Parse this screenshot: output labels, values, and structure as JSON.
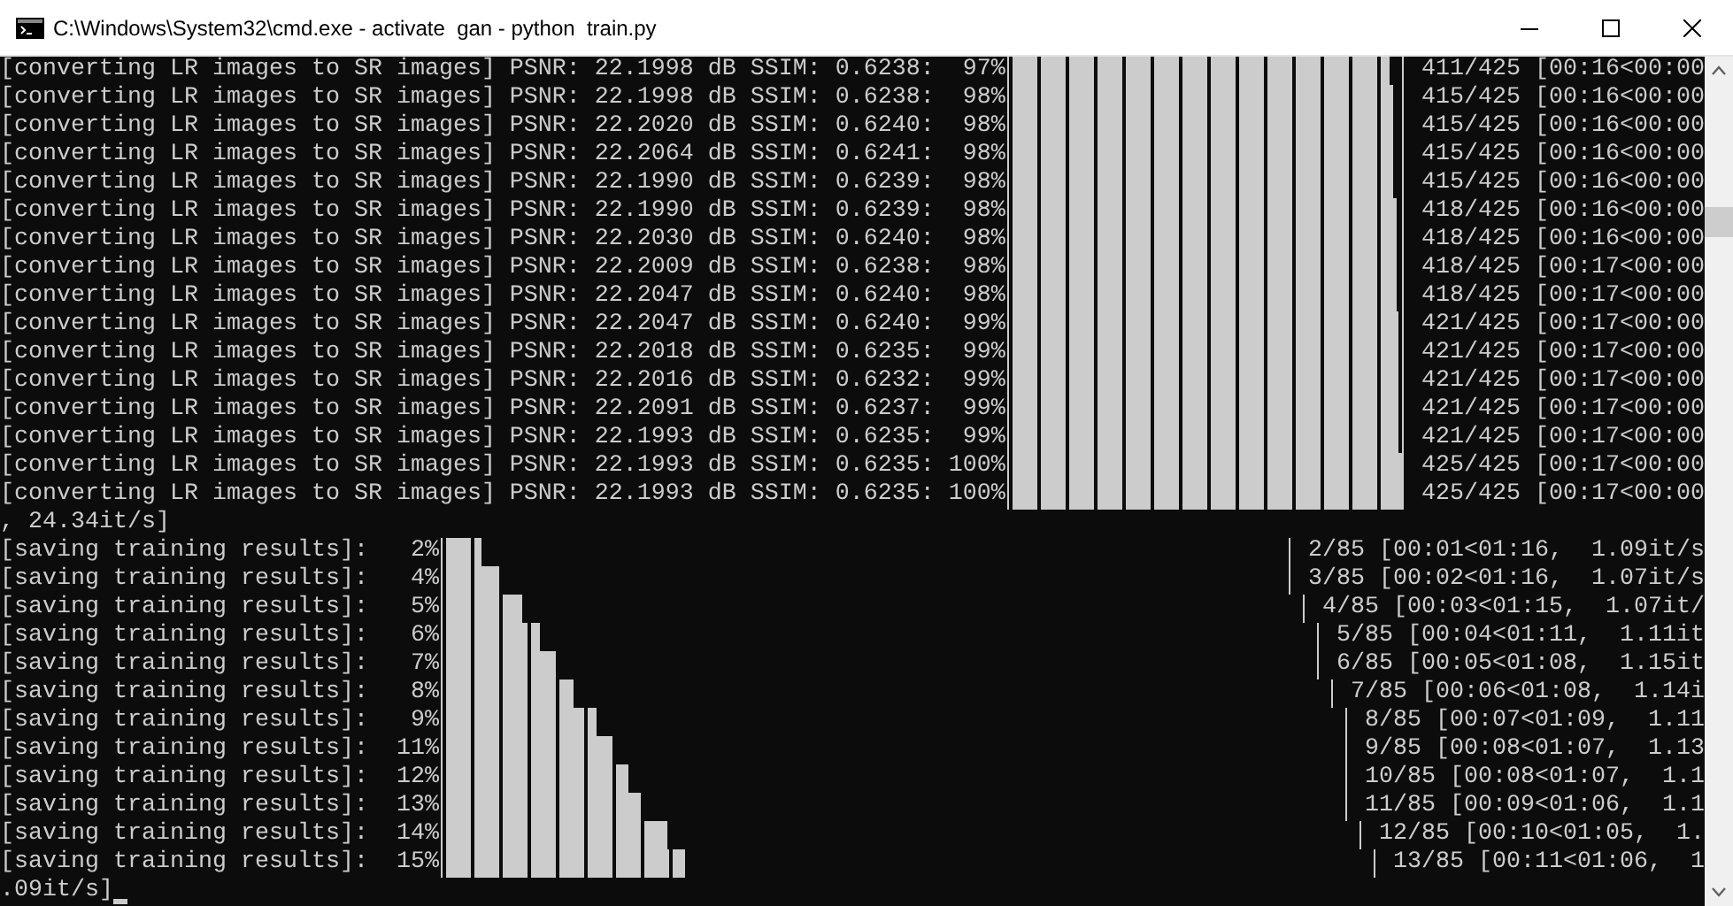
{
  "window": {
    "title": "C:\\Windows\\System32\\cmd.exe - activate  gan - python  train.py"
  },
  "console": {
    "lines": [
      {
        "kind": "progress",
        "prefix": "[converting LR images to SR images] PSNR: 22.1998 dB SSIM: 0.6238:  97%",
        "level": 0.967,
        "suffix": "411/425 [00:16<00:00"
      },
      {
        "kind": "progress",
        "prefix": "[converting LR images to SR images] PSNR: 22.1998 dB SSIM: 0.6238:  98%",
        "level": 0.976,
        "suffix": "415/425 [00:16<00:00"
      },
      {
        "kind": "progress",
        "prefix": "[converting LR images to SR images] PSNR: 22.2020 dB SSIM: 0.6240:  98%",
        "level": 0.976,
        "suffix": "415/425 [00:16<00:00"
      },
      {
        "kind": "progress",
        "prefix": "[converting LR images to SR images] PSNR: 22.2064 dB SSIM: 0.6241:  98%",
        "level": 0.976,
        "suffix": "415/425 [00:16<00:00"
      },
      {
        "kind": "progress",
        "prefix": "[converting LR images to SR images] PSNR: 22.1990 dB SSIM: 0.6239:  98%",
        "level": 0.976,
        "suffix": "415/425 [00:16<00:00"
      },
      {
        "kind": "progress",
        "prefix": "[converting LR images to SR images] PSNR: 22.1990 dB SSIM: 0.6239:  98%",
        "level": 0.984,
        "suffix": "418/425 [00:16<00:00"
      },
      {
        "kind": "progress",
        "prefix": "[converting LR images to SR images] PSNR: 22.2030 dB SSIM: 0.6240:  98%",
        "level": 0.984,
        "suffix": "418/425 [00:16<00:00"
      },
      {
        "kind": "progress",
        "prefix": "[converting LR images to SR images] PSNR: 22.2009 dB SSIM: 0.6238:  98%",
        "level": 0.984,
        "suffix": "418/425 [00:17<00:00"
      },
      {
        "kind": "progress",
        "prefix": "[converting LR images to SR images] PSNR: 22.2047 dB SSIM: 0.6240:  98%",
        "level": 0.984,
        "suffix": "418/425 [00:17<00:00"
      },
      {
        "kind": "progress",
        "prefix": "[converting LR images to SR images] PSNR: 22.2047 dB SSIM: 0.6240:  99%",
        "level": 0.991,
        "suffix": "421/425 [00:17<00:00"
      },
      {
        "kind": "progress",
        "prefix": "[converting LR images to SR images] PSNR: 22.2018 dB SSIM: 0.6235:  99%",
        "level": 0.991,
        "suffix": "421/425 [00:17<00:00"
      },
      {
        "kind": "progress",
        "prefix": "[converting LR images to SR images] PSNR: 22.2016 dB SSIM: 0.6232:  99%",
        "level": 0.991,
        "suffix": "421/425 [00:17<00:00"
      },
      {
        "kind": "progress",
        "prefix": "[converting LR images to SR images] PSNR: 22.2091 dB SSIM: 0.6237:  99%",
        "level": 0.991,
        "suffix": "421/425 [00:17<00:00"
      },
      {
        "kind": "progress",
        "prefix": "[converting LR images to SR images] PSNR: 22.1993 dB SSIM: 0.6235:  99%",
        "level": 0.991,
        "suffix": "421/425 [00:17<00:00"
      },
      {
        "kind": "progress",
        "prefix": "[converting LR images to SR images] PSNR: 22.1993 dB SSIM: 0.6235: 100%",
        "level": 1,
        "suffix": "425/425 [00:17<00:00"
      },
      {
        "kind": "progress",
        "prefix": "[converting LR images to SR images] PSNR: 22.1993 dB SSIM: 0.6235: 100%",
        "level": 1,
        "suffix": "425/425 [00:17<00:00"
      },
      {
        "kind": "text",
        "text": ", 24.34it/s]"
      },
      {
        "kind": "progress",
        "prefix": "[saving training results]:   2%",
        "level": 0.042,
        "suffix": "2/85 [00:01<01:16,  1.09it/s"
      },
      {
        "kind": "progress",
        "prefix": "[saving training results]:   4%",
        "level": 0.064,
        "suffix": "3/85 [00:02<01:16,  1.07it/s"
      },
      {
        "kind": "progress",
        "prefix": "[saving training results]:   5%",
        "level": 0.088,
        "suffix": "4/85 [00:03<01:15,  1.07it/"
      },
      {
        "kind": "progress",
        "prefix": "[saving training results]:   6%",
        "level": 0.107,
        "suffix": "5/85 [00:04<01:11,  1.11it"
      },
      {
        "kind": "progress",
        "prefix": "[saving training results]:   7%",
        "level": 0.127,
        "suffix": "6/85 [00:05<01:08,  1.15it"
      },
      {
        "kind": "progress",
        "prefix": "[saving training results]:   8%",
        "level": 0.145,
        "suffix": "7/85 [00:06<01:08,  1.14i"
      },
      {
        "kind": "progress",
        "prefix": "[saving training results]:   9%",
        "level": 0.167,
        "suffix": "8/85 [00:07<01:09,  1.11"
      },
      {
        "kind": "progress",
        "prefix": "[saving training results]:  11%",
        "level": 0.187,
        "suffix": "9/85 [00:08<01:07,  1.13"
      },
      {
        "kind": "progress",
        "prefix": "[saving training results]:  12%",
        "level": 0.202,
        "suffix": "10/85 [00:08<01:07,  1.1"
      },
      {
        "kind": "progress",
        "prefix": "[saving training results]:  13%",
        "level": 0.22,
        "suffix": "11/85 [00:09<01:06,  1.1"
      },
      {
        "kind": "progress",
        "prefix": "[saving training results]:  14%",
        "level": 0.242,
        "suffix": "12/85 [00:10<01:05,  1."
      },
      {
        "kind": "progress",
        "prefix": "[saving training results]:  15%",
        "level": 0.258,
        "suffix": "13/85 [00:11<01:06,  1"
      },
      {
        "kind": "text",
        "text": ".09it/s]",
        "cursor": true
      }
    ]
  }
}
